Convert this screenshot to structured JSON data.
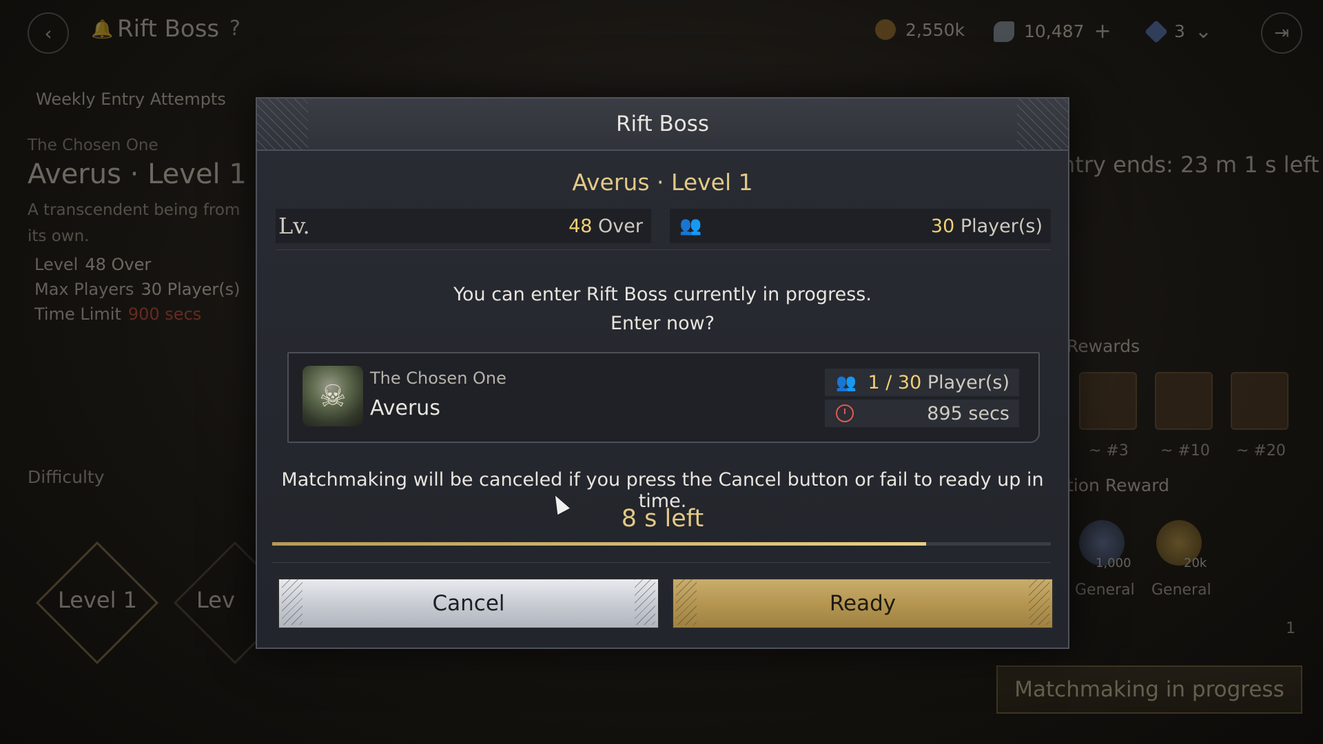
{
  "topbar": {
    "title": "Rift Boss",
    "help": "?",
    "currencies": [
      {
        "icon": "gold-coin-icon",
        "value": "2,550k"
      },
      {
        "icon": "feather-icon",
        "value": "10,487"
      },
      {
        "icon": "crystal-icon",
        "value": "3"
      }
    ]
  },
  "left_panel": {
    "attempts_label": "Weekly Entry Attempts",
    "chosen_label": "The Chosen One",
    "boss_title": "Averus · Level 1",
    "description": "A transcendent being from its own.",
    "level_label": "Level",
    "level_value": "48 Over",
    "max_players_label": "Max Players",
    "max_players_value": "30 Player(s)",
    "time_limit_label": "Time Limit",
    "time_limit_value": "900 secs",
    "difficulty_label": "Difficulty",
    "difficulty_selected": "Level 1",
    "difficulty_locked": "Lev"
  },
  "right_panel": {
    "entry_ends": "ntry ends: 23 m 1 s left",
    "rewards_label": "Rewards",
    "chests": [
      "~ #3",
      "~ #10",
      "~ #20"
    ],
    "participation_label": "tion Reward",
    "rewards": [
      {
        "amount": "1,000",
        "category": "General"
      },
      {
        "amount": "20k",
        "category": "General"
      }
    ],
    "count_value": "1",
    "matchmaking_label": "Matchmaking in progress"
  },
  "modal": {
    "title": "Rift Boss",
    "boss_name": "Averus · Level 1",
    "lv_label": "Lv.",
    "level_number": "48",
    "level_suffix": "Over",
    "players_number": "30",
    "players_suffix": "Player(s)",
    "message_line1": "You can enter Rift Boss currently in progress.",
    "message_line2": "Enter now?",
    "session": {
      "label": "The Chosen One",
      "name": "Averus",
      "players_current": "1 / 30",
      "players_suffix": "Player(s)",
      "time_remaining": "895 secs"
    },
    "warning": "Matchmaking will be canceled if you press the Cancel button or fail to ready up in time.",
    "countdown": "8 s left",
    "countdown_progress": 0.84,
    "cancel_label": "Cancel",
    "ready_label": "Ready"
  }
}
